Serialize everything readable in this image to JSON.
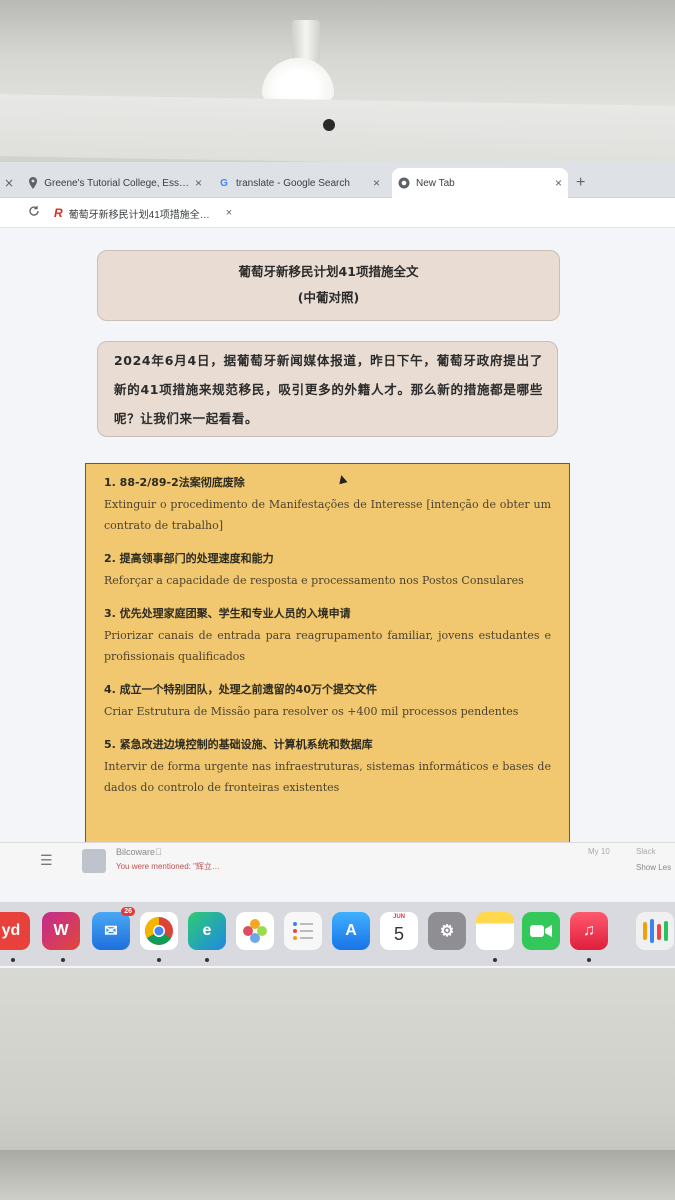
{
  "browser": {
    "tabs": [
      {
        "label": "Greene's Tutorial College, Ess…",
        "icon": "map-pin-icon",
        "active": false
      },
      {
        "label": "translate - Google Search",
        "icon": "google-icon",
        "active": false
      },
      {
        "label": "New Tab",
        "icon": "chrome-icon",
        "active": true
      }
    ],
    "new_tab_symbol": "+",
    "close_symbol": "×",
    "bookmark": {
      "label": "葡萄牙新移民计划41项措施全…",
      "icon": "r-logo-icon"
    }
  },
  "page": {
    "title_line1": "葡萄牙新移民计划41项措施全文",
    "title_line2": "(中葡对照)",
    "intro": "2024年6月4日，据葡萄牙新闻媒体报道，昨日下午，葡萄牙政府提出了新的41项措施来规范移民，吸引更多的外籍人才。那么新的措施都是哪些呢？让我们来一起看看。",
    "items": [
      {
        "title": "1. 88-2/89-2法案彻底废除",
        "text": "Extinguir o procedimento de Manifestações de Interesse [intenção de obter um contrato de trabalho]"
      },
      {
        "title": "2. 提高领事部门的处理速度和能力",
        "text": "Reforçar a capacidade de resposta e processamento nos Postos Consulares"
      },
      {
        "title": "3. 优先处理家庭团聚、学生和专业人员的入境申请",
        "text": "Priorizar canais de entrada para reagrupamento familiar, jovens estudantes e profissionais qualificados"
      },
      {
        "title": "4. 成立一个特别团队，处理之前遗留的40万个提交文件",
        "text": "Criar Estrutura de Missão para resolver os +400 mil processos pendentes"
      },
      {
        "title": "5. 紧急改进边境控制的基础设施、计算机系统和数据库",
        "text": "Intervir de forma urgente nas infraestruturas, sistemas informáticos e bases de dados do controlo de fronteiras existentes"
      }
    ]
  },
  "notification": {
    "title": "Bilcoware\u0000",
    "mention": "You were mentioned: \"辉立…",
    "time": "My 10",
    "link": "Slack",
    "more": "Show Les"
  },
  "dock": {
    "apps": [
      "yd",
      "wps",
      "mail",
      "chrome",
      "edge",
      "photos",
      "reminders",
      "app-store",
      "calendar",
      "settings",
      "notes",
      "facetime",
      "music",
      "launchpad"
    ],
    "mail_badge": "26",
    "calendar_month": "JUN",
    "calendar_day": "5"
  }
}
